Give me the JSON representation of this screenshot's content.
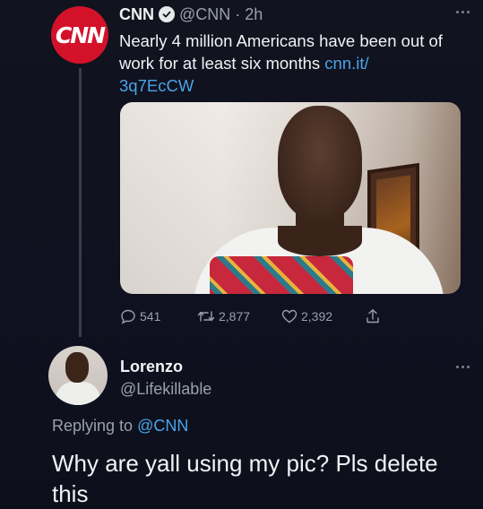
{
  "tweet": {
    "author_name": "CNN",
    "author_avatar_text": "CNN",
    "verified_icon": "verified-badge-icon",
    "handle": "@CNN",
    "separator": "·",
    "time": "2h",
    "text": "Nearly 4 million Americans have been out of work for at least six months ",
    "link": "cnn.it/\n3q7EcCW",
    "actions": {
      "replies": "541",
      "retweets": "2,877",
      "likes": "2,392"
    }
  },
  "reply": {
    "author_name": "Lorenzo",
    "handle": "@Lifekillable",
    "replying_prefix": "Replying to ",
    "replying_to": "@CNN",
    "text": "Why are yall using my pic? Pls delete this"
  },
  "colors": {
    "background": "#0d0f1a",
    "link": "#4aa4e8",
    "cnn_red": "#d3122a",
    "muted": "#9aa0ab"
  }
}
